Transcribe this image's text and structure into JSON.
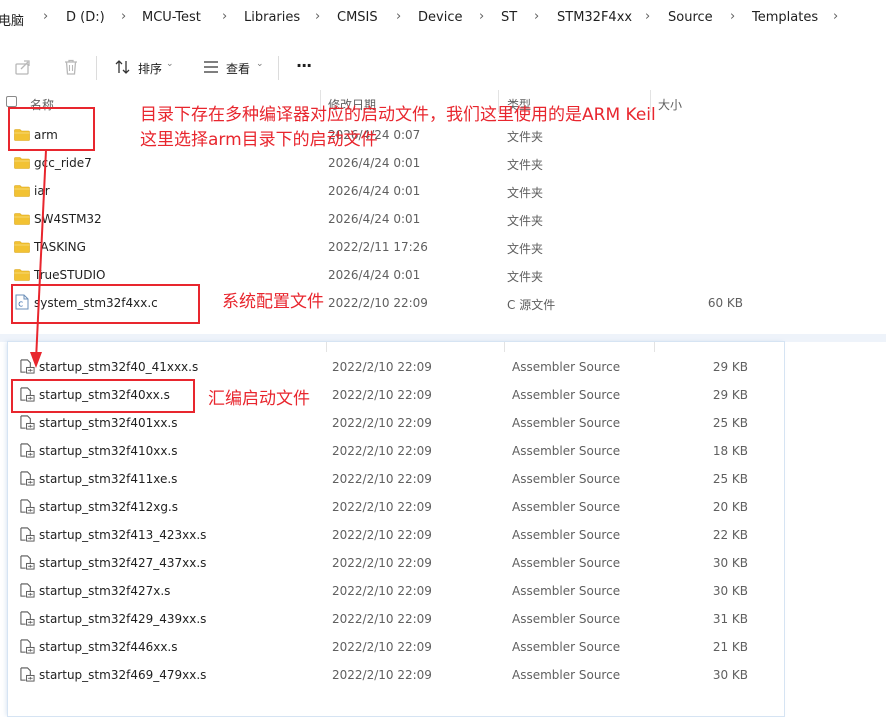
{
  "breadcrumb": [
    "电脑",
    "D (D:)",
    "MCU-Test",
    "Libraries",
    "CMSIS",
    "Device",
    "ST",
    "STM32F4xx",
    "Source",
    "Templates"
  ],
  "toolbar": {
    "sort_label": "排序",
    "view_label": "查看",
    "more_label": "···"
  },
  "columns": {
    "name": "名称",
    "date": "修改日期",
    "type": "类型",
    "size": "大小"
  },
  "top_files": [
    {
      "name": "arm",
      "date": "2026/4/24 0:07",
      "type": "文件夹",
      "size": "",
      "icon": "folder-icon"
    },
    {
      "name": "gcc_ride7",
      "date": "2026/4/24 0:01",
      "type": "文件夹",
      "size": "",
      "icon": "folder-icon"
    },
    {
      "name": "iar",
      "date": "2026/4/24 0:01",
      "type": "文件夹",
      "size": "",
      "icon": "folder-icon"
    },
    {
      "name": "SW4STM32",
      "date": "2026/4/24 0:01",
      "type": "文件夹",
      "size": "",
      "icon": "folder-icon"
    },
    {
      "name": "TASKING",
      "date": "2022/2/11 17:26",
      "type": "文件夹",
      "size": "",
      "icon": "folder-icon"
    },
    {
      "name": "TrueSTUDIO",
      "date": "2026/4/24 0:01",
      "type": "文件夹",
      "size": "",
      "icon": "folder-icon"
    },
    {
      "name": "system_stm32f4xx.c",
      "date": "2022/2/10 22:09",
      "type": "C 源文件",
      "size": "60 KB",
      "icon": "c-source-file-icon"
    }
  ],
  "asm_files": [
    {
      "name": "startup_stm32f40_41xxx.s",
      "date": "2022/2/10 22:09",
      "type": "Assembler Source",
      "size": "29 KB"
    },
    {
      "name": "startup_stm32f40xx.s",
      "date": "2022/2/10 22:09",
      "type": "Assembler Source",
      "size": "29 KB"
    },
    {
      "name": "startup_stm32f401xx.s",
      "date": "2022/2/10 22:09",
      "type": "Assembler Source",
      "size": "25 KB"
    },
    {
      "name": "startup_stm32f410xx.s",
      "date": "2022/2/10 22:09",
      "type": "Assembler Source",
      "size": "18 KB"
    },
    {
      "name": "startup_stm32f411xe.s",
      "date": "2022/2/10 22:09",
      "type": "Assembler Source",
      "size": "25 KB"
    },
    {
      "name": "startup_stm32f412xg.s",
      "date": "2022/2/10 22:09",
      "type": "Assembler Source",
      "size": "20 KB"
    },
    {
      "name": "startup_stm32f413_423xx.s",
      "date": "2022/2/10 22:09",
      "type": "Assembler Source",
      "size": "22 KB"
    },
    {
      "name": "startup_stm32f427_437xx.s",
      "date": "2022/2/10 22:09",
      "type": "Assembler Source",
      "size": "30 KB"
    },
    {
      "name": "startup_stm32f427x.s",
      "date": "2022/2/10 22:09",
      "type": "Assembler Source",
      "size": "30 KB"
    },
    {
      "name": "startup_stm32f429_439xx.s",
      "date": "2022/2/10 22:09",
      "type": "Assembler Source",
      "size": "31 KB"
    },
    {
      "name": "startup_stm32f446xx.s",
      "date": "2022/2/10 22:09",
      "type": "Assembler Source",
      "size": "21 KB"
    },
    {
      "name": "startup_stm32f469_479xx.s",
      "date": "2022/2/10 22:09",
      "type": "Assembler Source",
      "size": "30 KB"
    }
  ],
  "annotations": {
    "line1": "目录下存在多种编译器对应的启动文件，我们这里使用的是ARM Keil",
    "line2": "这里选择arm目录下的启动文件",
    "system_config": "系统配置文件",
    "asm_startup": "汇编启动文件"
  },
  "colors": {
    "accent_red": "#e8262e",
    "folder_yellow": "#f2c233",
    "text": "#1f1f1f",
    "muted": "#5f5f5f"
  }
}
